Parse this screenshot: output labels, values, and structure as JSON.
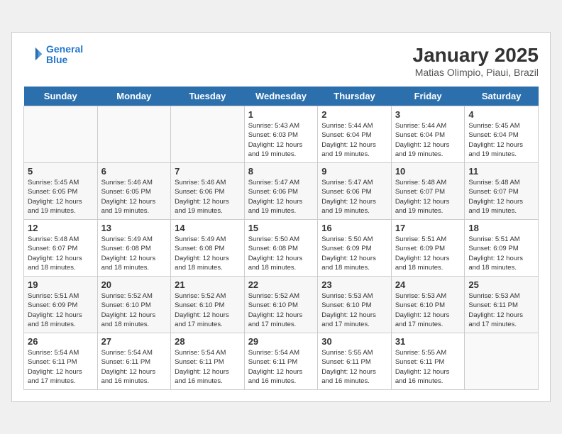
{
  "header": {
    "logo_line1": "General",
    "logo_line2": "Blue",
    "title": "January 2025",
    "subtitle": "Matias Olimpio, Piaui, Brazil"
  },
  "weekdays": [
    "Sunday",
    "Monday",
    "Tuesday",
    "Wednesday",
    "Thursday",
    "Friday",
    "Saturday"
  ],
  "weeks": [
    [
      {
        "day": "",
        "info": ""
      },
      {
        "day": "",
        "info": ""
      },
      {
        "day": "",
        "info": ""
      },
      {
        "day": "1",
        "info": "Sunrise: 5:43 AM\nSunset: 6:03 PM\nDaylight: 12 hours\nand 19 minutes."
      },
      {
        "day": "2",
        "info": "Sunrise: 5:44 AM\nSunset: 6:04 PM\nDaylight: 12 hours\nand 19 minutes."
      },
      {
        "day": "3",
        "info": "Sunrise: 5:44 AM\nSunset: 6:04 PM\nDaylight: 12 hours\nand 19 minutes."
      },
      {
        "day": "4",
        "info": "Sunrise: 5:45 AM\nSunset: 6:04 PM\nDaylight: 12 hours\nand 19 minutes."
      }
    ],
    [
      {
        "day": "5",
        "info": "Sunrise: 5:45 AM\nSunset: 6:05 PM\nDaylight: 12 hours\nand 19 minutes."
      },
      {
        "day": "6",
        "info": "Sunrise: 5:46 AM\nSunset: 6:05 PM\nDaylight: 12 hours\nand 19 minutes."
      },
      {
        "day": "7",
        "info": "Sunrise: 5:46 AM\nSunset: 6:06 PM\nDaylight: 12 hours\nand 19 minutes."
      },
      {
        "day": "8",
        "info": "Sunrise: 5:47 AM\nSunset: 6:06 PM\nDaylight: 12 hours\nand 19 minutes."
      },
      {
        "day": "9",
        "info": "Sunrise: 5:47 AM\nSunset: 6:06 PM\nDaylight: 12 hours\nand 19 minutes."
      },
      {
        "day": "10",
        "info": "Sunrise: 5:48 AM\nSunset: 6:07 PM\nDaylight: 12 hours\nand 19 minutes."
      },
      {
        "day": "11",
        "info": "Sunrise: 5:48 AM\nSunset: 6:07 PM\nDaylight: 12 hours\nand 19 minutes."
      }
    ],
    [
      {
        "day": "12",
        "info": "Sunrise: 5:48 AM\nSunset: 6:07 PM\nDaylight: 12 hours\nand 18 minutes."
      },
      {
        "day": "13",
        "info": "Sunrise: 5:49 AM\nSunset: 6:08 PM\nDaylight: 12 hours\nand 18 minutes."
      },
      {
        "day": "14",
        "info": "Sunrise: 5:49 AM\nSunset: 6:08 PM\nDaylight: 12 hours\nand 18 minutes."
      },
      {
        "day": "15",
        "info": "Sunrise: 5:50 AM\nSunset: 6:08 PM\nDaylight: 12 hours\nand 18 minutes."
      },
      {
        "day": "16",
        "info": "Sunrise: 5:50 AM\nSunset: 6:09 PM\nDaylight: 12 hours\nand 18 minutes."
      },
      {
        "day": "17",
        "info": "Sunrise: 5:51 AM\nSunset: 6:09 PM\nDaylight: 12 hours\nand 18 minutes."
      },
      {
        "day": "18",
        "info": "Sunrise: 5:51 AM\nSunset: 6:09 PM\nDaylight: 12 hours\nand 18 minutes."
      }
    ],
    [
      {
        "day": "19",
        "info": "Sunrise: 5:51 AM\nSunset: 6:09 PM\nDaylight: 12 hours\nand 18 minutes."
      },
      {
        "day": "20",
        "info": "Sunrise: 5:52 AM\nSunset: 6:10 PM\nDaylight: 12 hours\nand 18 minutes."
      },
      {
        "day": "21",
        "info": "Sunrise: 5:52 AM\nSunset: 6:10 PM\nDaylight: 12 hours\nand 17 minutes."
      },
      {
        "day": "22",
        "info": "Sunrise: 5:52 AM\nSunset: 6:10 PM\nDaylight: 12 hours\nand 17 minutes."
      },
      {
        "day": "23",
        "info": "Sunrise: 5:53 AM\nSunset: 6:10 PM\nDaylight: 12 hours\nand 17 minutes."
      },
      {
        "day": "24",
        "info": "Sunrise: 5:53 AM\nSunset: 6:10 PM\nDaylight: 12 hours\nand 17 minutes."
      },
      {
        "day": "25",
        "info": "Sunrise: 5:53 AM\nSunset: 6:11 PM\nDaylight: 12 hours\nand 17 minutes."
      }
    ],
    [
      {
        "day": "26",
        "info": "Sunrise: 5:54 AM\nSunset: 6:11 PM\nDaylight: 12 hours\nand 17 minutes."
      },
      {
        "day": "27",
        "info": "Sunrise: 5:54 AM\nSunset: 6:11 PM\nDaylight: 12 hours\nand 16 minutes."
      },
      {
        "day": "28",
        "info": "Sunrise: 5:54 AM\nSunset: 6:11 PM\nDaylight: 12 hours\nand 16 minutes."
      },
      {
        "day": "29",
        "info": "Sunrise: 5:54 AM\nSunset: 6:11 PM\nDaylight: 12 hours\nand 16 minutes."
      },
      {
        "day": "30",
        "info": "Sunrise: 5:55 AM\nSunset: 6:11 PM\nDaylight: 12 hours\nand 16 minutes."
      },
      {
        "day": "31",
        "info": "Sunrise: 5:55 AM\nSunset: 6:11 PM\nDaylight: 12 hours\nand 16 minutes."
      },
      {
        "day": "",
        "info": ""
      }
    ]
  ]
}
